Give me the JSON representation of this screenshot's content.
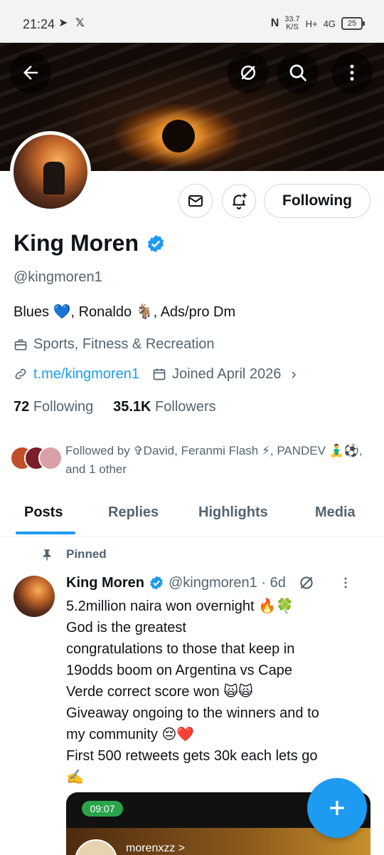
{
  "status_bar": {
    "time": "21:24",
    "net_speed": "33.7",
    "net_unit": "K/S",
    "signal1": "H+",
    "signal2": "4G",
    "battery": "25"
  },
  "profile": {
    "name": "King Moren",
    "handle": "@kingmoren1",
    "bio": "Blues 💙, Ronaldo 🐐, Ads/pro Dm",
    "category": "Sports, Fitness & Recreation",
    "link": "t.me/kingmoren1",
    "joined": "Joined April 2026",
    "following_count": "72",
    "following_label": "Following",
    "followers_count": "35.1K",
    "followers_label": "Followers",
    "followed_by": "Followed by ✞David, Feranmi Flash ⚡, PANDEV 🧘‍♂️⚽, and 1 other",
    "follow_button": "Following"
  },
  "tabs": [
    "Posts",
    "Replies",
    "Highlights",
    "Media"
  ],
  "post": {
    "pinned_label": "Pinned",
    "author": "King Moren",
    "handle_time": "@kingmoren1 · 6d",
    "lines": [
      "5.2million naira won overnight 🔥🍀",
      "God is the greatest",
      "congratulations to those that keep in",
      "19odds boom on Argentina vs Cape",
      "Verde correct score won 🙀🙀",
      "Giveaway ongoing to the winners and to",
      "my community 😔❤️",
      "First 500 retweets gets 30k each lets go",
      "✍️"
    ],
    "media_time": "09:07",
    "media_user": "morenxzz >"
  },
  "colors": {
    "accent": "#1d9bf0",
    "text": "#0f1419",
    "muted": "#536471"
  }
}
